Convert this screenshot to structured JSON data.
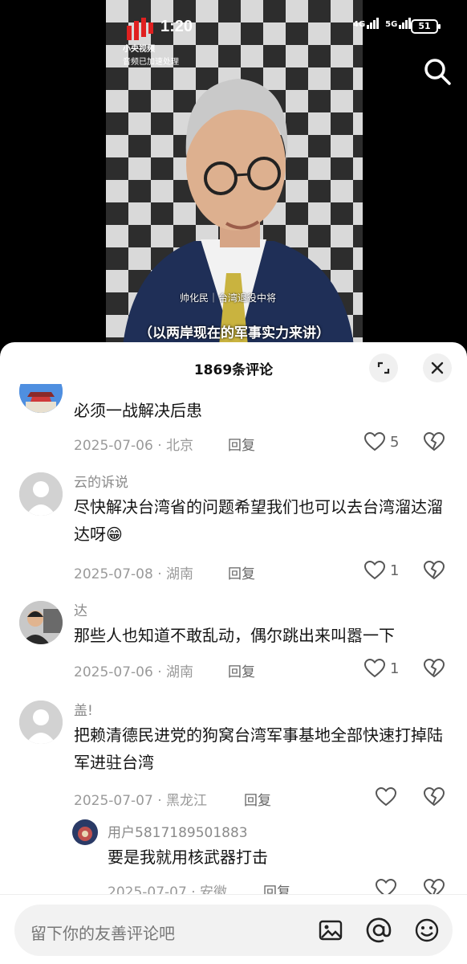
{
  "status": {
    "time": "1:20",
    "battery": "51",
    "net1": "4G",
    "net2": "5G"
  },
  "video": {
    "brand": "小央视频",
    "audio_note": "音频已加速处理",
    "name_tag": "帅化民｜台湾退役中将",
    "subtitle": "（以两岸现在的军事实力来讲）"
  },
  "sheet": {
    "title": "1869条评论"
  },
  "comments": [
    {
      "user": "",
      "text": "必须一战解决后患",
      "date": "2025-07-06",
      "location": "北京",
      "reply": "回复",
      "likes": "5"
    },
    {
      "user": "云的诉说",
      "text": "尽快解决台湾省的问题希望我们也可以去台湾溜达溜达呀😁",
      "date": "2025-07-08",
      "location": "湖南",
      "reply": "回复",
      "likes": "1"
    },
    {
      "user": "达",
      "text": "那些人也知道不敢乱动，偶尔跳出来叫嚣一下",
      "date": "2025-07-06",
      "location": "湖南",
      "reply": "回复",
      "likes": "1"
    },
    {
      "user": "盖!",
      "text": "把赖清德民进党的狗窝台湾军事基地全部快速打掉陆军进驻台湾",
      "date": "2025-07-07",
      "location": "黑龙江",
      "reply": "回复",
      "likes": ""
    }
  ],
  "subreply": {
    "user": "用户5817189501883",
    "text": "要是我就用核武器打击",
    "date": "2025-07-07",
    "location": "安徽",
    "reply": "回复"
  },
  "input": {
    "placeholder": "留下你的友善评论吧"
  }
}
